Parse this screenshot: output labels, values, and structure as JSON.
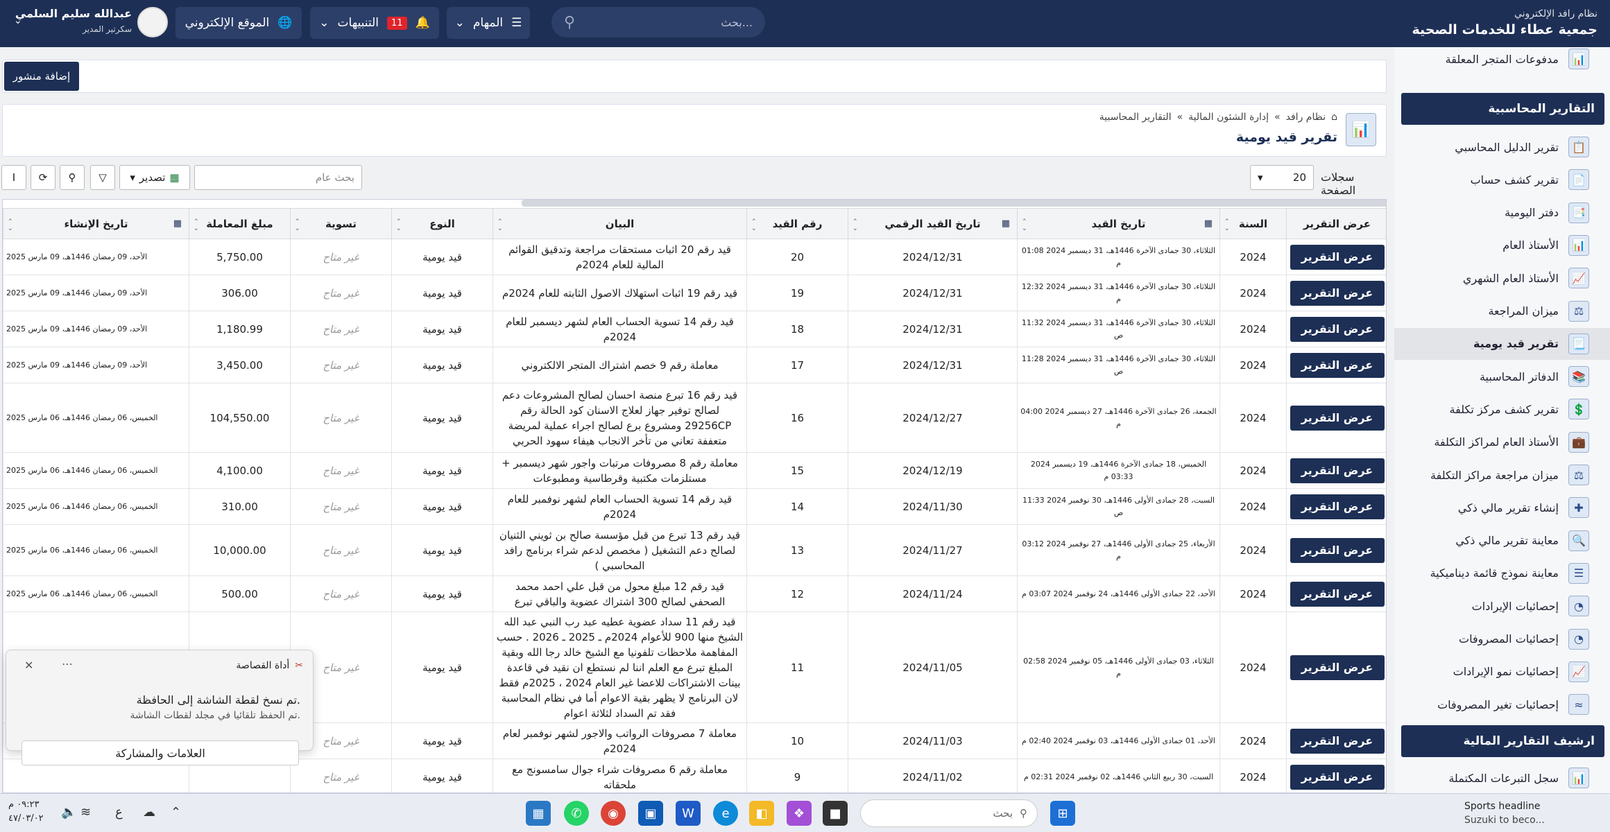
{
  "brand": {
    "system": "نظام رافد الإلكتروني",
    "org": "جمعية عطاء للخدمات الصحية"
  },
  "topbar": {
    "search_placeholder": "بحث...",
    "tasks_label": "المهام",
    "notifications_label": "التنبيهات",
    "notifications_count": "11",
    "website_label": "الموقع الإلكتروني",
    "user_name": "عبدالله سليم السلمي",
    "user_role": "سكرتير المدير"
  },
  "sidebar": {
    "items_top": [
      "مدفوعات المتجر المعلقة"
    ],
    "section1": "التقارير المحاسبية",
    "items": [
      "تقرير الدليل المحاسبي",
      "تقرير كشف حساب",
      "دفتر اليومية",
      "الأستاذ العام",
      "الأستاذ العام الشهري",
      "ميزان المراجعة",
      "تقرير قيد يومية",
      "الدفاتر المحاسبية",
      "تقرير كشف مركز تكلفة",
      "الأستاذ العام لمراكز التكلفة",
      "ميزان مراجعة مراكز التكلفة",
      "إنشاء تقرير مالي ذكي",
      "معاينة تقرير مالي ذكي",
      "معاينة نموذج قائمة ديناميكية",
      "إحصائيات الإيرادات",
      "إحصائيات المصروفات",
      "إحصائيات نمو الإيرادات",
      "إحصائيات تغير المصروفات"
    ],
    "section2": "ارشيف التقارير المالية",
    "items_bottom": [
      "سجل التبرعات المكتملة"
    ]
  },
  "post": {
    "add_label": "إضافة منشور"
  },
  "header": {
    "crumbs": [
      "نظام رافد",
      "إدارة الشئون المالية",
      "التقارير المحاسبية"
    ],
    "title": "تقرير قيد يومية"
  },
  "toolbar": {
    "records_label": "سجلات الصفحة",
    "records_value": "20",
    "search_placeholder": "بحث عام",
    "export_label": "تصدير"
  },
  "table": {
    "headers": [
      "عرض التقرير",
      "السنة",
      "تاريخ القيد",
      "تاريخ القيد الرقمي",
      "رقم القيد",
      "البيان",
      "النوع",
      "تسوية",
      "مبلغ المعاملة",
      "تاريخ الإنشاء"
    ],
    "view_label": "عرض التقرير",
    "rows": [
      {
        "year": "2024",
        "date": "الثلاثاء، 30 جمادى الآخرة 1446هـ، 31 ديسمبر 2024 01:08 م",
        "digital": "2024/12/31",
        "no": "20",
        "desc": "قيد رقم 20 اثبات مستحقات مراجعة وتدقيق القوائم المالية للعام 2024م",
        "type": "قيد يومية",
        "settle": "غير متاح",
        "amount": "5,750.00",
        "created": "الأحد، 09 رمضان 1446هـ، 09 مارس 2025"
      },
      {
        "year": "2024",
        "date": "الثلاثاء، 30 جمادى الآخرة 1446هـ، 31 ديسمبر 2024 12:32 م",
        "digital": "2024/12/31",
        "no": "19",
        "desc": "قيد رقم 19 اثبات استهلاك الاصول الثابته للعام 2024م",
        "type": "قيد يومية",
        "settle": "غير متاح",
        "amount": "306.00",
        "created": "الأحد، 09 رمضان 1446هـ، 09 مارس 2025"
      },
      {
        "year": "2024",
        "date": "الثلاثاء، 30 جمادى الآخرة 1446هـ، 31 ديسمبر 2024 11:32 ص",
        "digital": "2024/12/31",
        "no": "18",
        "desc": "قيد رقم 14 تسوية الحساب العام لشهر ديسمبر للعام 2024م",
        "type": "قيد يومية",
        "settle": "غير متاح",
        "amount": "1,180.99",
        "created": "الأحد، 09 رمضان 1446هـ، 09 مارس 2025"
      },
      {
        "year": "2024",
        "date": "الثلاثاء، 30 جمادى الآخرة 1446هـ، 31 ديسمبر 2024 11:28 ص",
        "digital": "2024/12/31",
        "no": "17",
        "desc": "معاملة رقم 9 خصم اشتراك المتجر الالكتروني",
        "type": "قيد يومية",
        "settle": "غير متاح",
        "amount": "3,450.00",
        "created": "الأحد، 09 رمضان 1446هـ، 09 مارس 2025"
      },
      {
        "year": "2024",
        "date": "الجمعة، 26 جمادى الآخرة 1446هـ، 27 ديسمبر 2024 04:00 م",
        "digital": "2024/12/27",
        "no": "16",
        "desc": "قيد رقم 16 تبرع منصة احسان لصالح المشروعات دعم لصالح توفير جهاز لعلاج الاسنان كود الحالة رقم 29256CP ومشروع برع لصالح اجراء عملية لمريضة متعففة تعاني من تأخر الانجاب هيفاء سهود الحربي",
        "type": "قيد يومية",
        "settle": "غير متاح",
        "amount": "104,550.00",
        "created": "الخميس، 06 رمضان 1446هـ، 06 مارس 2025"
      },
      {
        "year": "2024",
        "date": "الخميس، 18 جمادى الآخرة 1446هـ، 19 ديسمبر 2024 03:33 م",
        "digital": "2024/12/19",
        "no": "15",
        "desc": "معاملة رقم 8 مصروفات مرتبات واجور شهر ديسمبر + مستلزمات مكتبية وقرطاسية ومطبوعات",
        "type": "قيد يومية",
        "settle": "غير متاح",
        "amount": "4,100.00",
        "created": "الخميس، 06 رمضان 1446هـ، 06 مارس 2025"
      },
      {
        "year": "2024",
        "date": "السبت، 28 جمادى الأولى 1446هـ، 30 نوفمبر 2024 11:33 ص",
        "digital": "2024/11/30",
        "no": "14",
        "desc": "قيد رقم 14 تسوية الحساب العام لشهر نوفمبر للعام 2024م",
        "type": "قيد يومية",
        "settle": "غير متاح",
        "amount": "310.00",
        "created": "الخميس، 06 رمضان 1446هـ، 06 مارس 2025"
      },
      {
        "year": "2024",
        "date": "الأربعاء، 25 جمادى الأولى 1446هـ، 27 نوفمبر 2024 03:12 م",
        "digital": "2024/11/27",
        "no": "13",
        "desc": "قيد رقم 13 تبرع من قبل مؤسسة صالح بن ثويني الثنيان لصالح دعم التشغيل ( مخصص لدعم شراء برنامج رافد المحاسبي )",
        "type": "قيد يومية",
        "settle": "غير متاح",
        "amount": "10,000.00",
        "created": "الخميس، 06 رمضان 1446هـ، 06 مارس 2025"
      },
      {
        "year": "2024",
        "date": "الأحد، 22 جمادى الأولى 1446هـ، 24 نوفمبر 2024 03:07 م",
        "digital": "2024/11/24",
        "no": "12",
        "desc": "قيد رقم 12 مبلغ محول من قبل علي احمد محمد الصحفي لصالح 300 اشتراك عضوية والباقي تبرع",
        "type": "قيد يومية",
        "settle": "غير متاح",
        "amount": "500.00",
        "created": "الخميس، 06 رمضان 1446هـ، 06 مارس 2025"
      },
      {
        "year": "2024",
        "date": "الثلاثاء، 03 جمادى الأولى 1446هـ، 05 نوفمبر 2024 02:58 م",
        "digital": "2024/11/05",
        "no": "11",
        "desc": "قيد رقم 11 سداد عضوية عطيه عبد رب النبي عبد الله الشيخ منها 900 للأعوام 2024م ـ 2025 ـ 2026 . حسب المفاهمة ملاحظات تلفونيا مع الشيخ خالد رجا الله وبقية المبلغ تبرع مع العلم اننا لم نستطع ان نقيد في قاعدة بينات الاشتراكات للاعضا غير العام 2024 ، 2025م فقط لان البرنامج لا يظهر بقية الاعوام أما في نظام المحاسبة فقد تم السداد لثلاثة اعوام",
        "type": "قيد يومية",
        "settle": "غير متاح",
        "amount": "",
        "created": ""
      },
      {
        "year": "2024",
        "date": "الأحد، 01 جمادى الأولى 1446هـ، 03 نوفمبر 2024 02:40 م",
        "digital": "2024/11/03",
        "no": "10",
        "desc": "معاملة 7 مصروفات الرواتب والاجور لشهر نوفمبر لعام 2024م",
        "type": "قيد يومية",
        "settle": "غير متاح",
        "amount": "",
        "created": ""
      },
      {
        "year": "2024",
        "date": "السبت، 30 ربيع الثاني 1446هـ، 02 نوفمبر 2024 02:31 م",
        "digital": "2024/11/02",
        "no": "9",
        "desc": "معاملة رقم 6 مصروفات شراء جوال سامسونج مع ملحقاته",
        "type": "قيد يومية",
        "settle": "غير متاح",
        "amount": "",
        "created": ""
      }
    ]
  },
  "toast": {
    "app": "أداة القصاصة",
    "line1": "تم نسخ لقطة الشاشة إلى الحافظة.",
    "line2": "تم الحفظ تلقائيا في مجلد لقطات الشاشة.",
    "button": "العلامات والمشاركة"
  },
  "taskbar": {
    "time": "٠٩:٢٣ م",
    "date": "٤٧/٠٣/٠٢",
    "search_label": "بحث",
    "lang": "ع",
    "news_title": "Sports headline",
    "news_sub": "Suzuki to beco..."
  }
}
